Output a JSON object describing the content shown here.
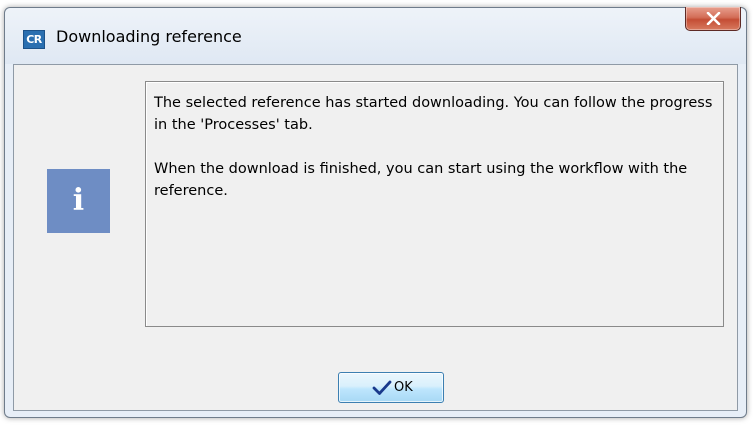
{
  "window": {
    "title": "Downloading reference",
    "app_icon_text": "CR",
    "close_icon": "close-icon"
  },
  "message": {
    "paragraph1": "The selected reference has started downloading. You can follow the progress in the 'Processes' tab.",
    "paragraph2": "When the download is finished, you can start using the workflow with the reference."
  },
  "icon": {
    "name": "info-icon",
    "glyph": "i",
    "color": "#6e8dc4"
  },
  "buttons": {
    "ok_label": "OK",
    "ok_icon": "checkmark-icon"
  }
}
